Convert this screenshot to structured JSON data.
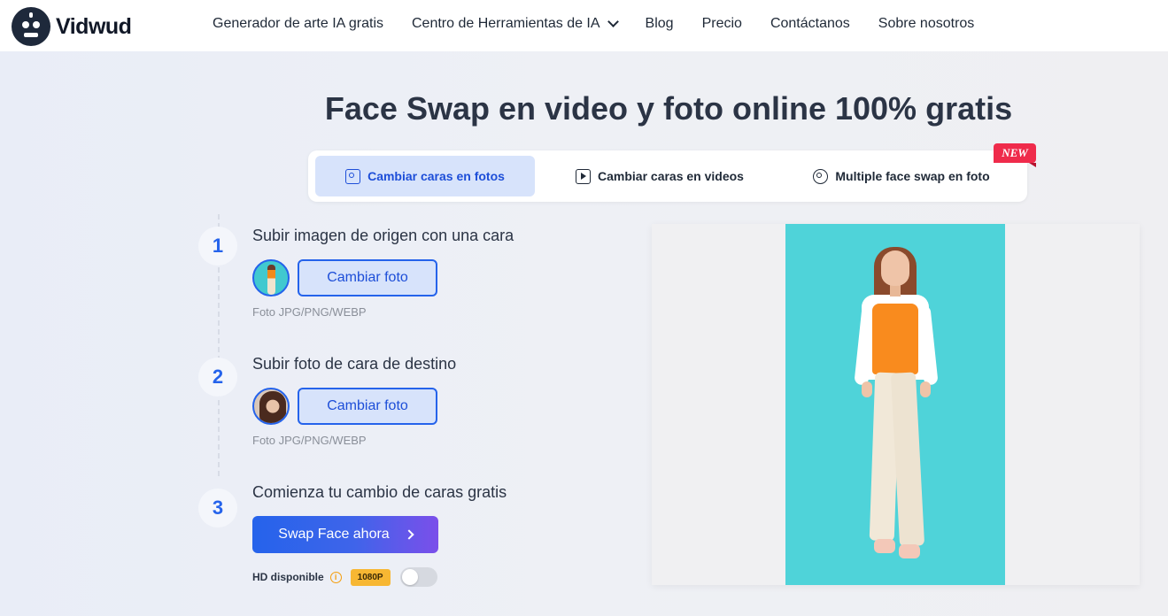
{
  "brand": {
    "name": "Vidwud"
  },
  "nav": {
    "items": [
      {
        "label": "Generador de arte IA gratis"
      },
      {
        "label": "Centro de Herramientas de IA",
        "icon": "chevron-down-icon"
      },
      {
        "label": "Blog"
      },
      {
        "label": "Precio"
      },
      {
        "label": "Contáctanos"
      },
      {
        "label": "Sobre nosotros"
      }
    ]
  },
  "page": {
    "title": "Face Swap en video y foto online 100% gratis"
  },
  "tabs": [
    {
      "label": "Cambiar caras en fotos",
      "icon": "image-icon",
      "active": true
    },
    {
      "label": "Cambiar caras en videos",
      "icon": "play-icon",
      "active": false
    },
    {
      "label": "Multiple face swap en foto",
      "icon": "multi-face-icon",
      "active": false,
      "badge": "NEW"
    }
  ],
  "steps": [
    {
      "number": "1",
      "title": "Subir imagen de origen con una cara",
      "button": "Cambiar foto",
      "hint": "Foto JPG/PNG/WEBP"
    },
    {
      "number": "2",
      "title": "Subir foto de cara de destino",
      "button": "Cambiar foto",
      "hint": "Foto JPG/PNG/WEBP"
    },
    {
      "number": "3",
      "title": "Comienza tu cambio de caras gratis",
      "button": "Swap Face ahora"
    }
  ],
  "hd": {
    "label": "HD disponible",
    "resolution": "1080P",
    "enabled": false
  },
  "colors": {
    "accent": "#2563eb",
    "accent_light": "#d7e3fb",
    "badge_red": "#ef2b4b",
    "hd_yellow": "#f7b733",
    "photo_bg": "#4fd3d9"
  }
}
